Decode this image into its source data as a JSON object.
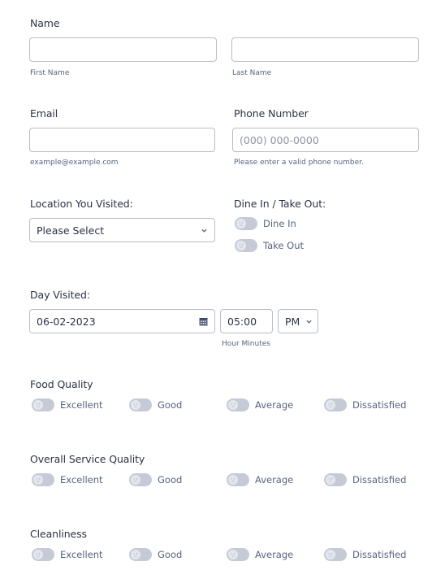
{
  "name": {
    "label": "Name",
    "first": {
      "value": "",
      "sublabel": "First Name"
    },
    "last": {
      "value": "",
      "sublabel": "Last Name"
    }
  },
  "email": {
    "label": "Email",
    "value": "",
    "sublabel": "example@example.com"
  },
  "phone": {
    "label": "Phone Number",
    "placeholder": "(000) 000-0000",
    "sublabel": "Please enter a valid phone number."
  },
  "location": {
    "label": "Location You Visited:",
    "selected": "Please Select"
  },
  "dine": {
    "label": "Dine In / Take Out:",
    "options": [
      {
        "label": "Dine In",
        "checked": false
      },
      {
        "label": "Take Out",
        "checked": false
      }
    ]
  },
  "day": {
    "label": "Day Visited:",
    "date": "06-02-2023",
    "time": "05:00",
    "ampm": "PM",
    "time_sublabel": "Hour Minutes"
  },
  "ratings": [
    {
      "label": "Food Quality",
      "options": [
        "Excellent",
        "Good",
        "Average",
        "Dissatisfied"
      ]
    },
    {
      "label": "Overall Service Quality",
      "options": [
        "Excellent",
        "Good",
        "Average",
        "Dissatisfied"
      ]
    },
    {
      "label": "Cleanliness",
      "options": [
        "Excellent",
        "Good",
        "Average",
        "Dissatisfied"
      ]
    }
  ],
  "colors": {
    "border": "#b8bdc9",
    "toggle_off": "#c5cad6",
    "text": "#2c3345",
    "subtext": "#57647e"
  }
}
